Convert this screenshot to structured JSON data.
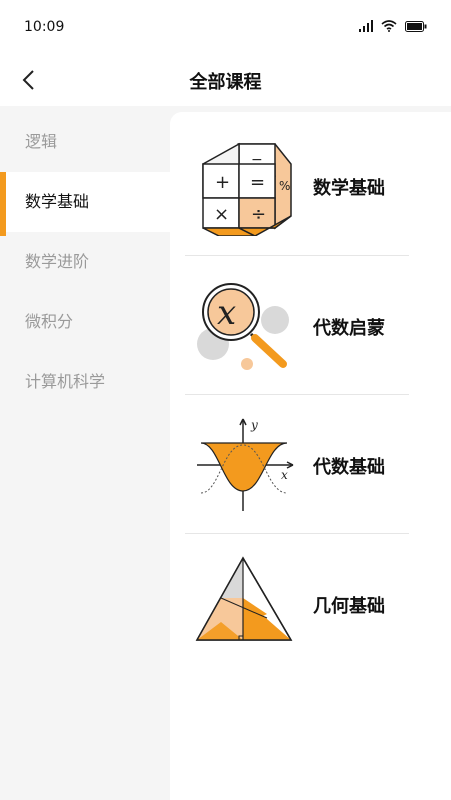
{
  "status": {
    "time": "10:09"
  },
  "nav": {
    "title": "全部课程"
  },
  "sidebar": {
    "items": [
      {
        "label": "逻辑"
      },
      {
        "label": "数学基础"
      },
      {
        "label": "数学进阶"
      },
      {
        "label": "微积分"
      },
      {
        "label": "计算机科学"
      }
    ],
    "active_index": 1
  },
  "courses": [
    {
      "title": "数学基础",
      "icon": "calculator-cube-icon"
    },
    {
      "title": "代数启蒙",
      "icon": "magnifier-x-icon"
    },
    {
      "title": "代数基础",
      "icon": "bell-curve-graph-icon"
    },
    {
      "title": "几何基础",
      "icon": "triangle-icon"
    }
  ],
  "colors": {
    "accent": "#f39a1e",
    "light_accent": "#f7c89a"
  }
}
